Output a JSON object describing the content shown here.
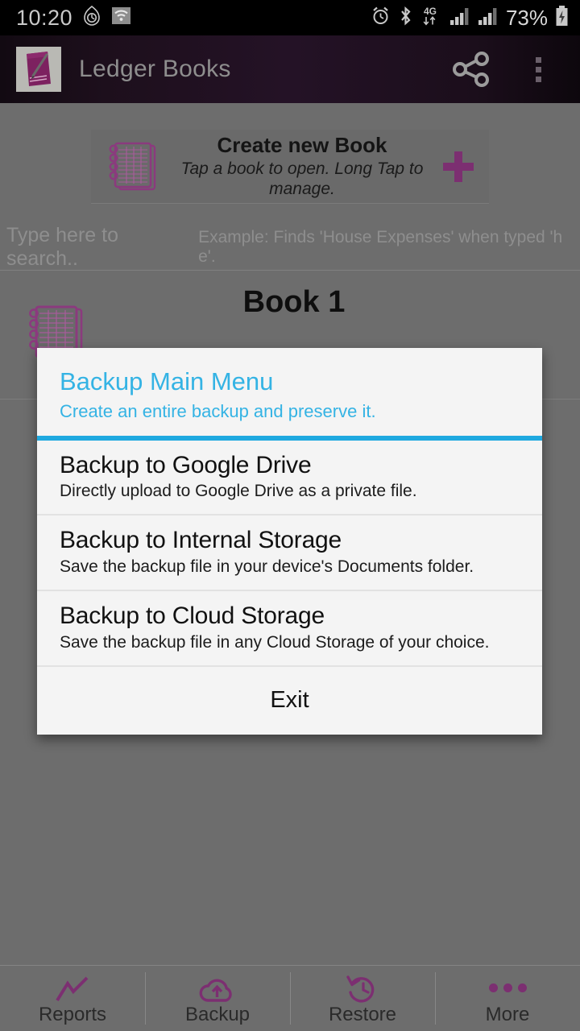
{
  "status_bar": {
    "time": "10:20",
    "battery_percent": "73%",
    "network": "4G",
    "left_icons": [
      "clock-icon",
      "prayer-time-icon",
      "wifi-icon"
    ],
    "right_icons": [
      "alarm-icon",
      "bluetooth-icon",
      "mobile-data-icon",
      "signal-bars-icon",
      "signal-bars-2-icon",
      "battery-charging-icon"
    ]
  },
  "app_bar": {
    "title": "Ledger Books",
    "icon": "app-book-icon",
    "share_icon": "share-icon",
    "overflow_icon": "overflow-menu-icon"
  },
  "create_card": {
    "title": "Create new Book",
    "subtitle": "Tap a book to open. Long Tap to manage.",
    "icon": "notebook-icon",
    "add_icon": "plus-icon"
  },
  "search": {
    "hint": "Type here to search..",
    "example": "Example: Finds 'House Expenses' when typed 'h e'."
  },
  "books": [
    {
      "name": "Book 1",
      "icon": "notebook-icon"
    }
  ],
  "dialog": {
    "title": "Backup Main Menu",
    "subtitle": "Create an entire backup and preserve it.",
    "accent_color": "#1fa9e0",
    "items": [
      {
        "title": "Backup to Google Drive",
        "subtitle": "Directly upload to Google Drive as a private file."
      },
      {
        "title": "Backup to Internal Storage",
        "subtitle": "Save the backup file in your device's Documents folder."
      },
      {
        "title": "Backup to Cloud Storage",
        "subtitle": "Save the backup file in any Cloud Storage of your choice."
      }
    ],
    "exit_label": "Exit"
  },
  "bottom_nav": {
    "items": [
      {
        "label": "Reports",
        "icon": "line-chart-icon"
      },
      {
        "label": "Backup",
        "icon": "cloud-upload-icon"
      },
      {
        "label": "Restore",
        "icon": "restore-clock-icon"
      },
      {
        "label": "More",
        "icon": "more-dots-icon"
      }
    ]
  },
  "colors": {
    "accent_purple": "#7c2f71",
    "dialog_accent": "#1fa9e0",
    "scrim": "#6d6d6d"
  }
}
